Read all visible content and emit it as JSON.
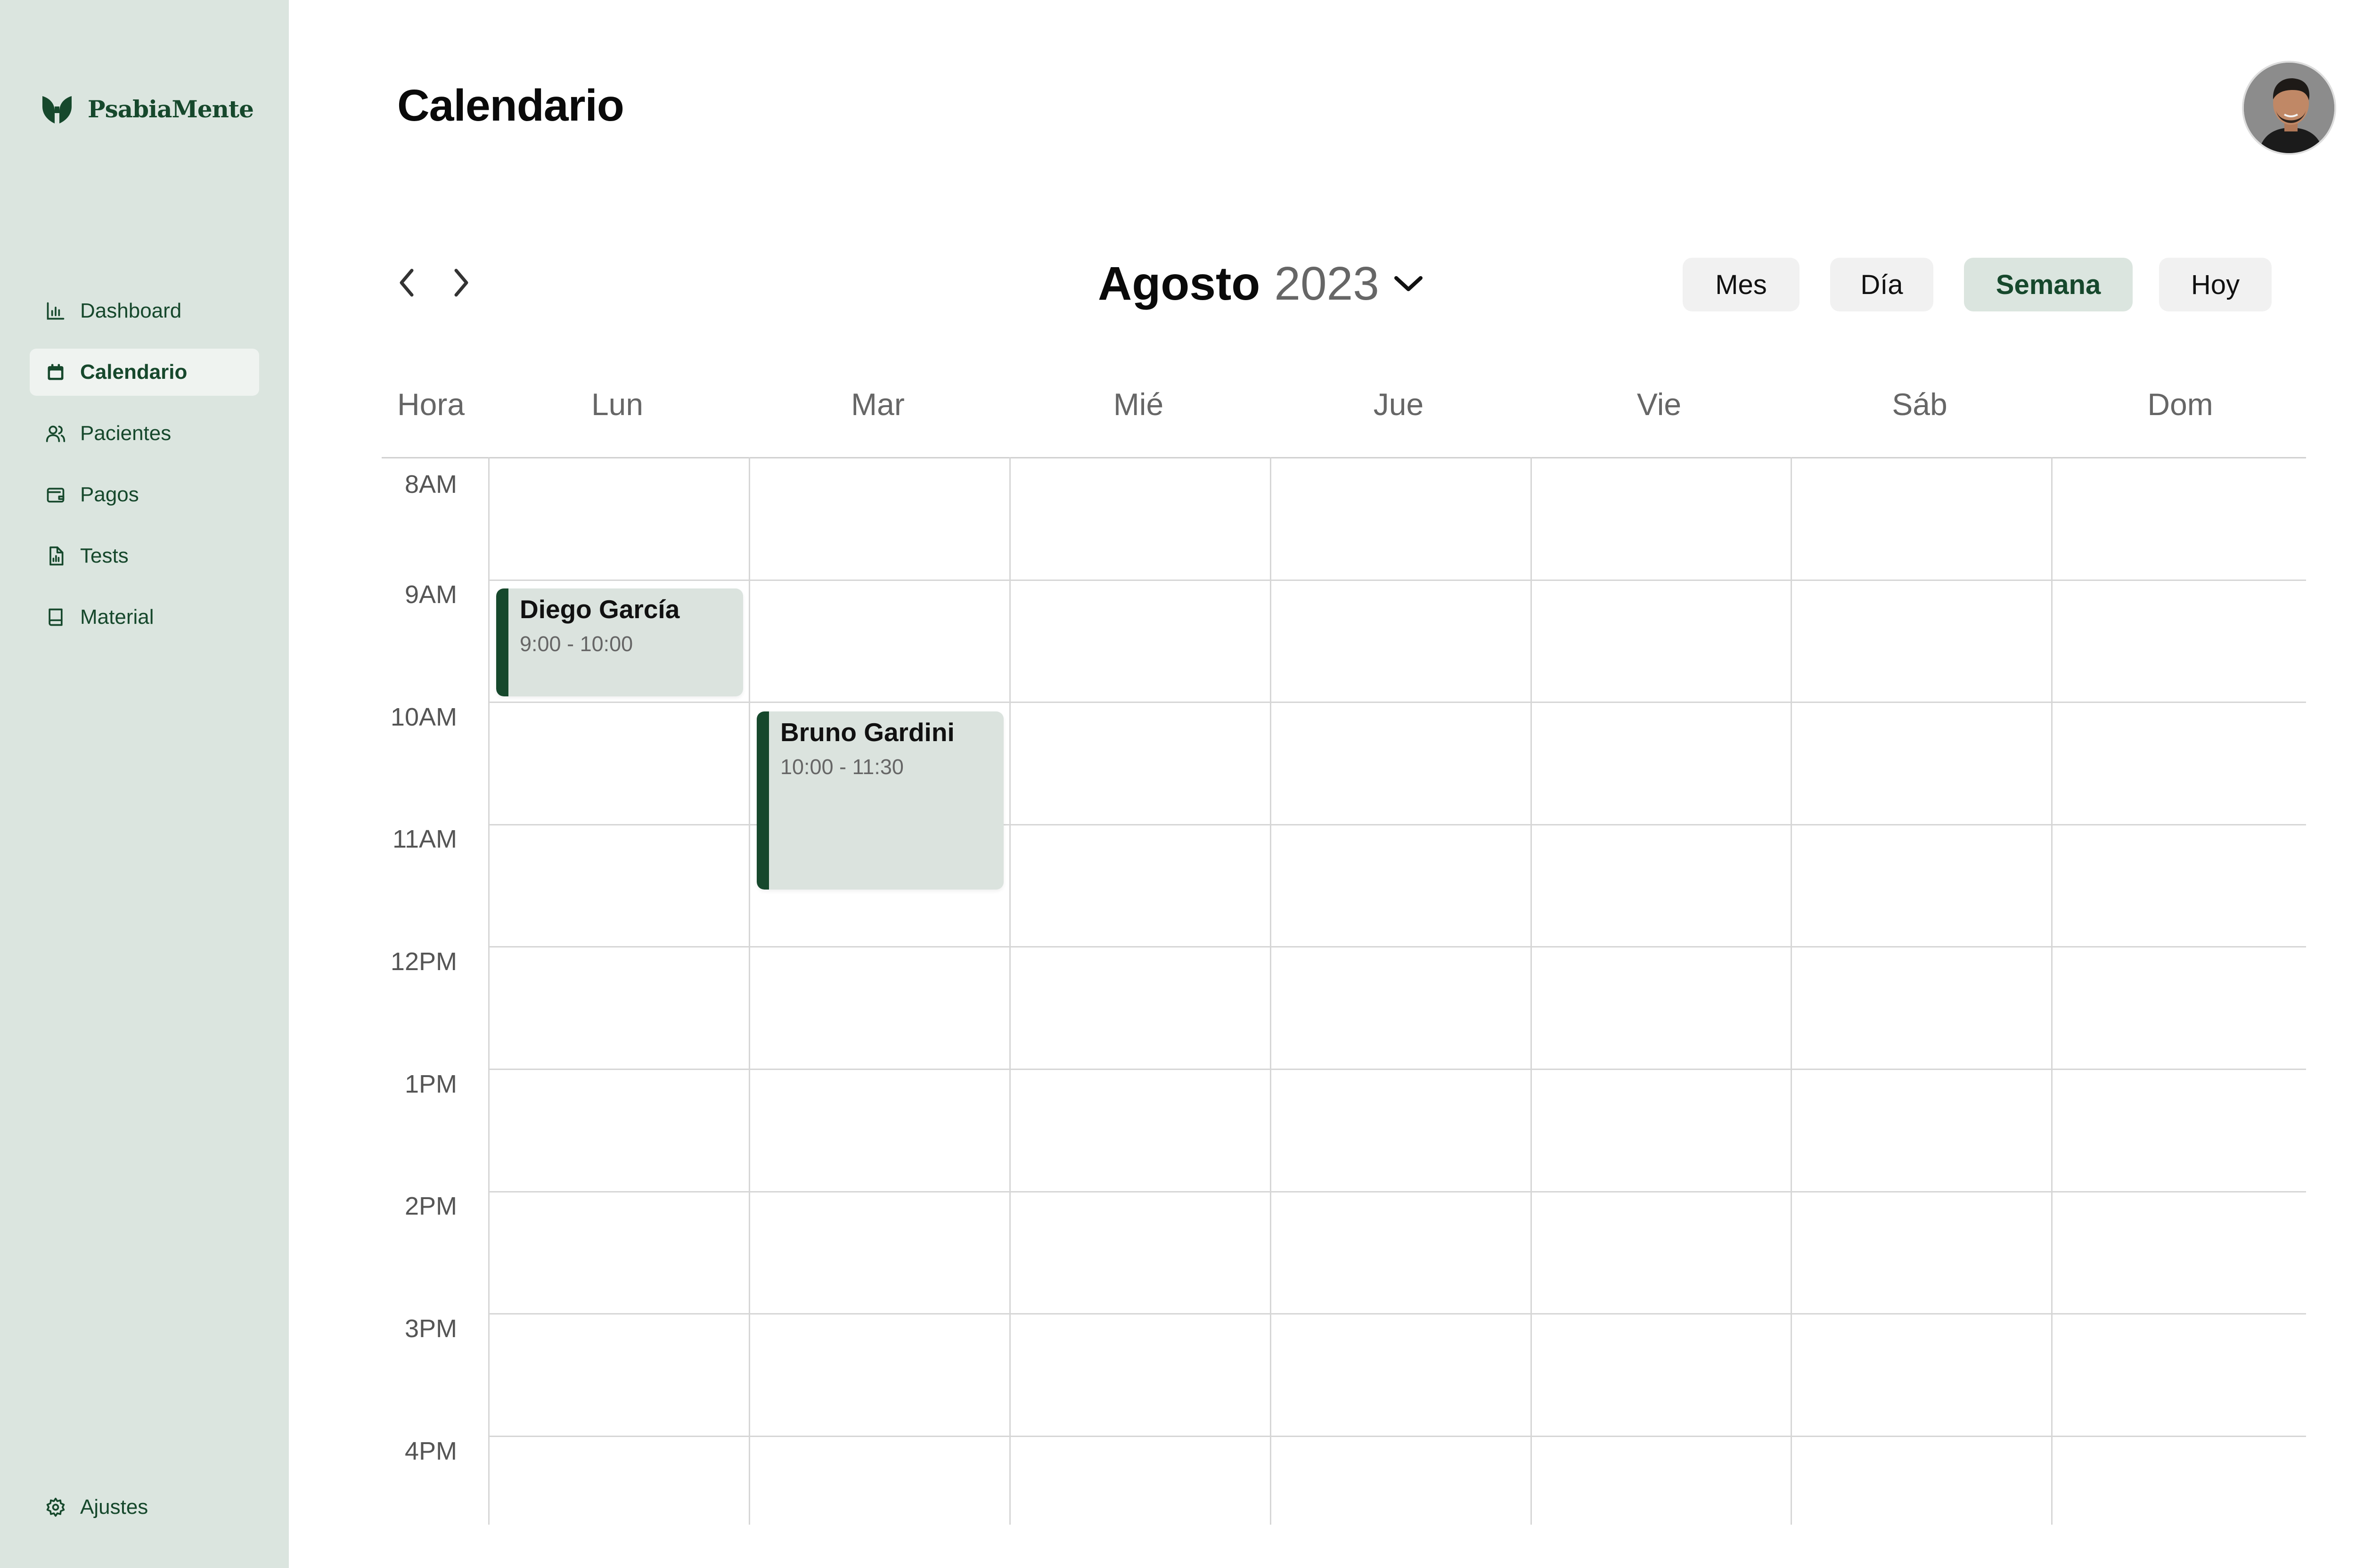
{
  "app": {
    "brand": "PsabiaMente"
  },
  "colors": {
    "brand": "#16482c",
    "sidebar_bg": "#dbe5df",
    "active_item_bg": "#eff3f0",
    "button_bg": "#f1f1f1"
  },
  "sidebar": {
    "items": [
      {
        "label": "Dashboard",
        "icon": "bar-chart-icon",
        "active": false
      },
      {
        "label": "Calendario",
        "icon": "calendar-icon",
        "active": true
      },
      {
        "label": "Pacientes",
        "icon": "users-icon",
        "active": false
      },
      {
        "label": "Pagos",
        "icon": "wallet-icon",
        "active": false
      },
      {
        "label": "Tests",
        "icon": "document-chart-icon",
        "active": false
      },
      {
        "label": "Material",
        "icon": "book-icon",
        "active": false
      }
    ],
    "settings": {
      "label": "Ajustes",
      "icon": "gear-icon"
    }
  },
  "header": {
    "title": "Calendario",
    "avatar": "user-avatar"
  },
  "toolbar": {
    "month": "Agosto",
    "year": "2023",
    "views": [
      {
        "label": "Mes",
        "active": false
      },
      {
        "label": "Día",
        "active": false
      },
      {
        "label": "Semana",
        "active": true
      },
      {
        "label": "Hoy",
        "active": false
      }
    ]
  },
  "calendar": {
    "hour_header": "Hora",
    "days": [
      "Lun",
      "Mar",
      "Mié",
      "Jue",
      "Vie",
      "Sáb",
      "Dom"
    ],
    "hours": [
      "8AM",
      "9AM",
      "10AM",
      "11AM",
      "12PM",
      "1PM",
      "2PM",
      "3PM",
      "4PM"
    ],
    "events": [
      {
        "name": "Diego García",
        "time": "9:00 - 10:00",
        "day": "Lun"
      },
      {
        "name": "Bruno Gardini",
        "time": "10:00 - 11:30",
        "day": "Mar"
      }
    ]
  }
}
